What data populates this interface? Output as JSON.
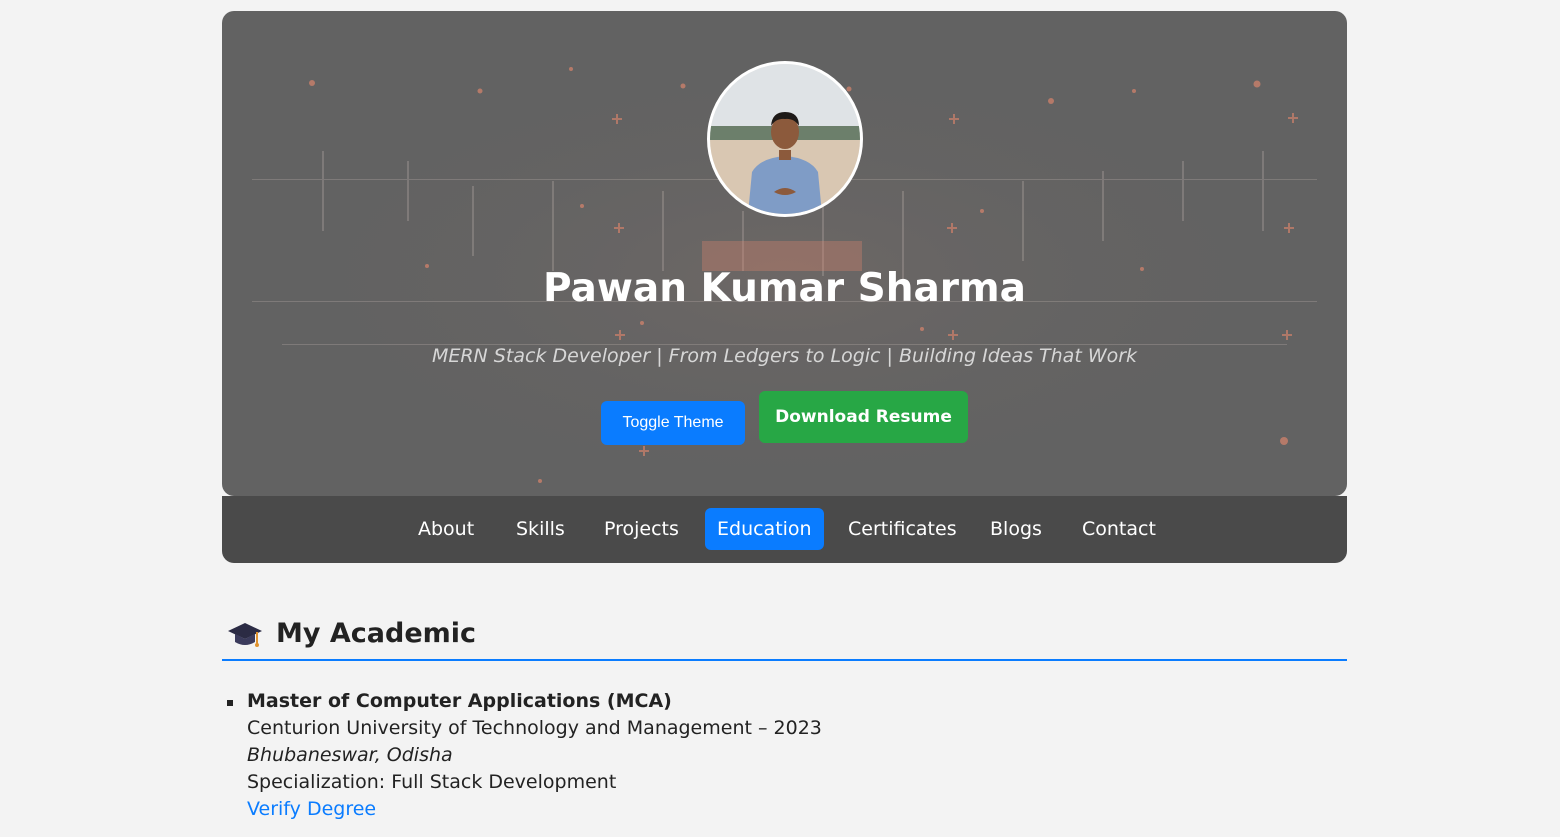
{
  "hero": {
    "name": "Pawan Kumar Sharma",
    "tagline": "MERN Stack Developer | From Ledgers to Logic | Building Ideas That Work",
    "toggle_theme_label": "Toggle Theme",
    "download_resume_label": "Download Resume"
  },
  "nav": {
    "items": [
      {
        "label": "About"
      },
      {
        "label": "Skills"
      },
      {
        "label": "Projects"
      },
      {
        "label": "Education"
      },
      {
        "label": "Certificates"
      },
      {
        "label": "Blogs"
      },
      {
        "label": "Contact"
      }
    ],
    "active": "Education"
  },
  "section": {
    "icon": "graduation-cap-icon",
    "title": "My Academic"
  },
  "education": [
    {
      "degree": "Master of Computer Applications (MCA)",
      "institution": "Centurion University of Technology and Management – 2023",
      "location": "Bhubaneswar, Odisha",
      "specialization": "Specialization: Full Stack Development",
      "link_label": "Verify Degree"
    }
  ],
  "colors": {
    "primary": "#0a7cff",
    "success": "#27a745",
    "hero_bg": "#626262",
    "nav_bg": "#4a4a4a",
    "page_bg": "#f3f3f3",
    "particle": "#d9846c"
  }
}
